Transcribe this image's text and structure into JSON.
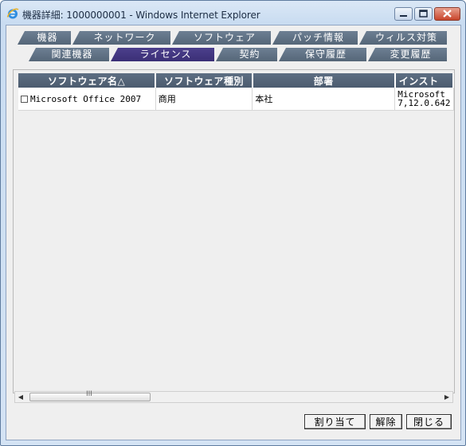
{
  "window": {
    "title": "機器詳細: 1000000001 - Windows Internet Explorer",
    "controls": {
      "minimize": "minimize",
      "maximize": "maximize",
      "close": "close"
    }
  },
  "tabs": {
    "row1": [
      {
        "label": "機器"
      },
      {
        "label": "ネットワーク"
      },
      {
        "label": "ソフトウェア"
      },
      {
        "label": "パッチ情報"
      },
      {
        "label": "ウィルス対策"
      }
    ],
    "row2": [
      {
        "label": "関連機器"
      },
      {
        "label": "ライセンス",
        "active": true
      },
      {
        "label": "契約"
      },
      {
        "label": "保守履歴"
      },
      {
        "label": "変更履歴"
      }
    ]
  },
  "table": {
    "columns": [
      "ソフトウェア名△",
      "ソフトウェア種別",
      "部署",
      "インスト"
    ],
    "rows": [
      {
        "checked": false,
        "name": "Microsoft Office 2007",
        "type": "商用",
        "dept": "本社",
        "install_line1": "Microsoft",
        "install_line2": "7,12.0.642"
      }
    ]
  },
  "scrollbar": {
    "thumb_grip": "III"
  },
  "buttons": {
    "assign": "割り当て",
    "release": "解除",
    "close": "閉じる"
  },
  "colors": {
    "tab_inactive": "#5e6f83",
    "tab_active": "#3f3480",
    "header_bg": "#55667a"
  }
}
